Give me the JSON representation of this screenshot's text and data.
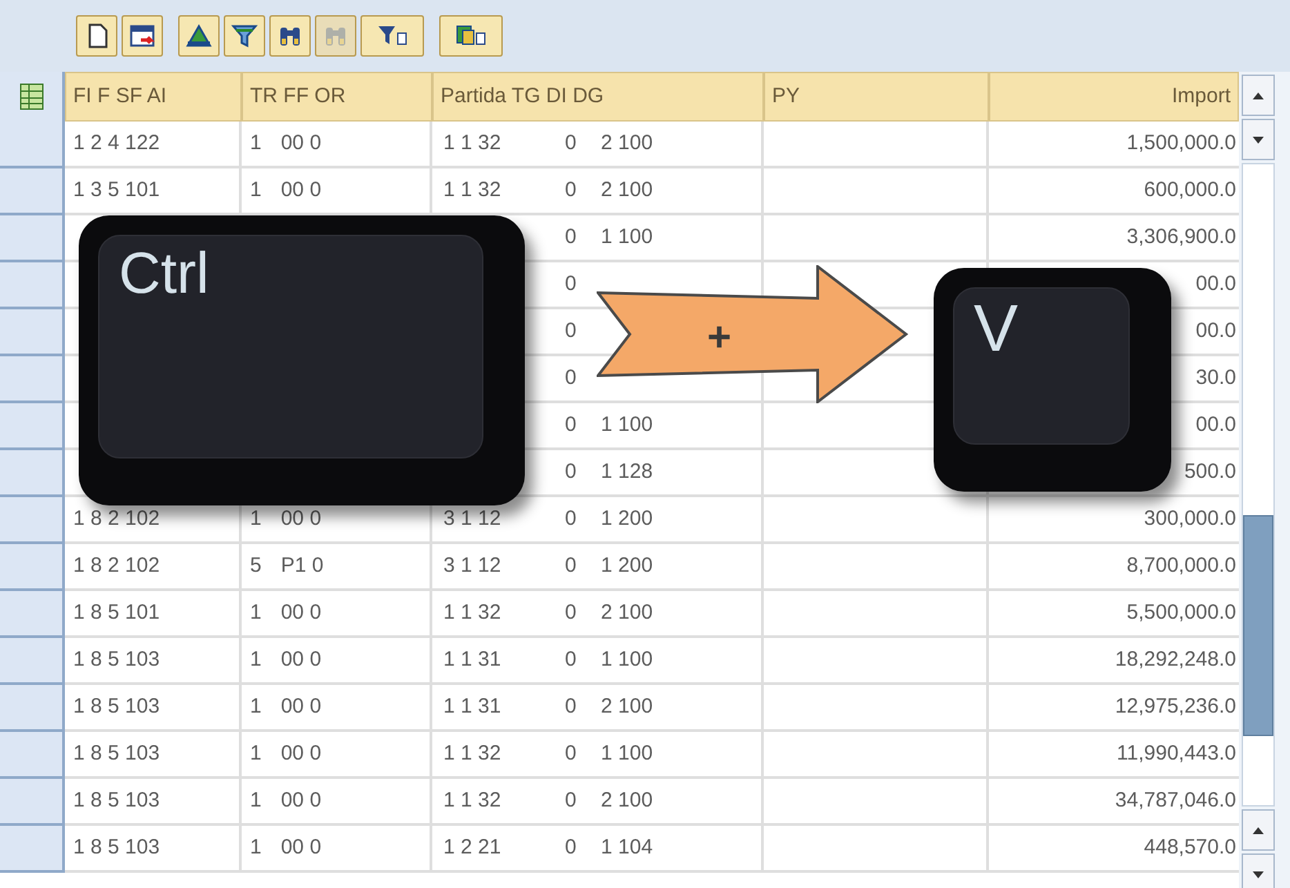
{
  "toolbar": [
    {
      "kind": "document",
      "disabled": false
    },
    {
      "kind": "save",
      "disabled": false
    },
    {
      "kind": "triangle",
      "disabled": false
    },
    {
      "kind": "funnel",
      "disabled": false
    },
    {
      "kind": "binoculars",
      "disabled": false
    },
    {
      "kind": "binoculars",
      "disabled": true
    },
    {
      "kind": "filter_menu",
      "disabled": false
    },
    {
      "kind": "export_menu",
      "disabled": false
    }
  ],
  "table": {
    "columns": [
      "FI F SF AI",
      "TR FF OR",
      "Partida TG DI DG",
      "PY",
      "Import"
    ],
    "rows": [
      {
        "fi": "1 2 4 122",
        "tr": "1",
        "ff": "00 0",
        "partida": "1 1 32",
        "tg": "0",
        "dg": "2 100",
        "importe": "1,500,000.0"
      },
      {
        "fi": "1 3 5 101",
        "tr": "1",
        "ff": "00 0",
        "partida": "1 1 32",
        "tg": "0",
        "dg": "2 100",
        "importe": "600,000.0"
      },
      {
        "tg": "0",
        "dg": "1 100",
        "importe": "3,306,900.0"
      },
      {
        "tg": "0",
        "importe": "00.0"
      },
      {
        "tg": "0",
        "importe": "00.0"
      },
      {
        "tg": "0",
        "importe": "30.0"
      },
      {
        "tg": "0",
        "dg": "1 100",
        "importe": "00.0"
      },
      {
        "tg": "0",
        "dg": "1 128",
        "importe": "500.0"
      },
      {
        "fi": "1 8 2 102",
        "tr": "1",
        "ff": "00 0",
        "partida": "3 1 12",
        "tg": "0",
        "dg": "1 200",
        "importe": "300,000.0"
      },
      {
        "fi": "1 8 2 102",
        "tr": "5",
        "ff": "P1 0",
        "partida": "3 1 12",
        "tg": "0",
        "dg": "1 200",
        "importe": "8,700,000.0"
      },
      {
        "fi": "1 8 5 101",
        "tr": "1",
        "ff": "00 0",
        "partida": "1 1 32",
        "tg": "0",
        "dg": "2 100",
        "importe": "5,500,000.0"
      },
      {
        "fi": "1 8 5 103",
        "tr": "1",
        "ff": "00 0",
        "partida": "1 1 31",
        "tg": "0",
        "dg": "1 100",
        "importe": "18,292,248.0"
      },
      {
        "fi": "1 8 5 103",
        "tr": "1",
        "ff": "00 0",
        "partida": "1 1 31",
        "tg": "0",
        "dg": "2 100",
        "importe": "12,975,236.0"
      },
      {
        "fi": "1 8 5 103",
        "tr": "1",
        "ff": "00 0",
        "partida": "1 1 32",
        "tg": "0",
        "dg": "1 100",
        "importe": "11,990,443.0"
      },
      {
        "fi": "1 8 5 103",
        "tr": "1",
        "ff": "00 0",
        "partida": "1 1 32",
        "tg": "0",
        "dg": "2 100",
        "importe": "34,787,046.0"
      },
      {
        "fi": "1 8 5 103",
        "tr": "1",
        "ff": "00 0",
        "partida": "1 2 21",
        "tg": "0",
        "dg": "1 104",
        "importe": "448,570.0"
      }
    ]
  },
  "overlay": {
    "keys": [
      {
        "label": "Ctrl"
      },
      {
        "label": "V"
      }
    ],
    "connector": "+"
  }
}
